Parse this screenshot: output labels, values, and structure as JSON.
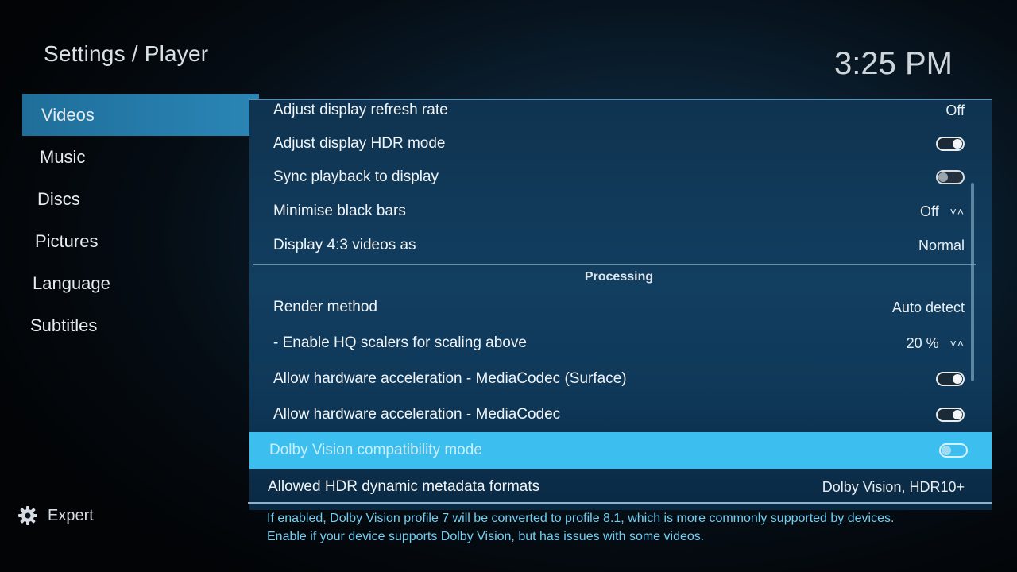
{
  "header": {
    "title": "Settings / Player",
    "clock": "3:25 PM"
  },
  "sidebar": {
    "items": [
      {
        "label": "Videos",
        "active": true
      },
      {
        "label": "Music"
      },
      {
        "label": "Discs"
      },
      {
        "label": "Pictures"
      },
      {
        "label": "Language"
      },
      {
        "label": "Subtitles"
      }
    ]
  },
  "footer": {
    "expert_label": "Expert",
    "icon": "gear-icon"
  },
  "settings": {
    "rows": [
      {
        "label": "Adjust display refresh rate",
        "value": "Off"
      },
      {
        "label": "Adjust display HDR mode",
        "toggle": "on"
      },
      {
        "label": "Sync playback to display",
        "toggle": "off"
      },
      {
        "label": "Minimise black bars",
        "value": "Off",
        "spinner": "˅˄"
      },
      {
        "label": "Display 4:3 videos as",
        "value": "Normal"
      }
    ],
    "section_title": "Processing",
    "processing_rows": [
      {
        "label": "Render method",
        "value": "Auto detect"
      },
      {
        "label": "- Enable HQ scalers for scaling above",
        "value": "20 %",
        "spinner": "˅˄"
      },
      {
        "label": "Allow hardware acceleration - MediaCodec (Surface)",
        "toggle": "on"
      },
      {
        "label": "Allow hardware acceleration - MediaCodec",
        "toggle": "on"
      },
      {
        "label": "Dolby Vision compatibility mode",
        "toggle": "off",
        "focused": true
      },
      {
        "label": "Allowed HDR dynamic metadata formats",
        "value": "Dolby Vision, HDR10+"
      }
    ]
  },
  "help": {
    "line1": "If enabled, Dolby Vision profile 7 will be converted to profile 8.1, which is more commonly supported by devices.",
    "line2": "Enable if your device supports Dolby Vision, but has issues with some videos."
  },
  "colors": {
    "focus": "#3cbfee",
    "active_sidebar": "#2a86b6",
    "help_text": "#6fd0f2"
  }
}
